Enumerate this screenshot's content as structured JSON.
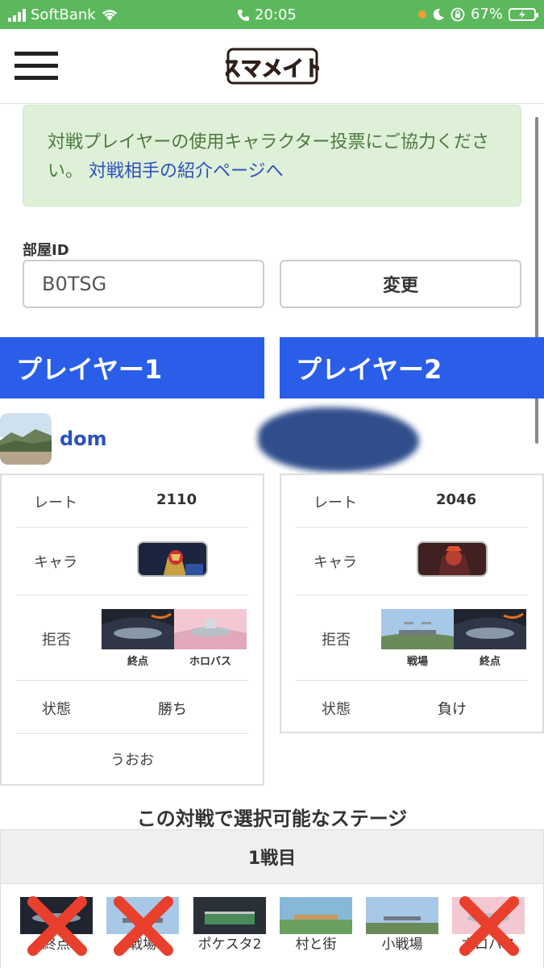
{
  "status_bar": {
    "carrier": "SoftBank",
    "time": "20:05",
    "battery": "67%"
  },
  "header": {
    "logo_text": "スマメイト"
  },
  "notice": {
    "text": "対戦プレイヤーの使用キャラクター投票にご協力ください。",
    "link": "対戦相手の紹介ページへ"
  },
  "room": {
    "label": "部屋ID",
    "value": "B0TSG",
    "button": "変更"
  },
  "players": [
    {
      "banner": "プレイヤー1",
      "name": "dom",
      "rate_label": "レート",
      "rate": "2110",
      "char_label": "キャラ",
      "reject_label": "拒否",
      "rejects": [
        "終点",
        "ホロバス"
      ],
      "status_label": "状態",
      "status": "勝ち",
      "comment": "うおお"
    },
    {
      "banner": "プレイヤー2",
      "rate_label": "レート",
      "rate": "2046",
      "char_label": "キャラ",
      "reject_label": "拒否",
      "rejects": [
        "戦場",
        "終点"
      ],
      "status_label": "状態",
      "status": "負け"
    }
  ],
  "selectable": {
    "title": "この対戦で選択可能なステージ",
    "game": "1戦目",
    "stages": [
      "終点",
      "戦場",
      "ポケスタ2",
      "村と街",
      "小戦場",
      "ホロバス"
    ],
    "banned": [
      true,
      true,
      false,
      false,
      false,
      true
    ]
  },
  "colors": {
    "accent": "#2a5ee8",
    "status_bar": "#5cb85c",
    "notice_bg": "#dff0d8",
    "ban": "#e8402c"
  }
}
